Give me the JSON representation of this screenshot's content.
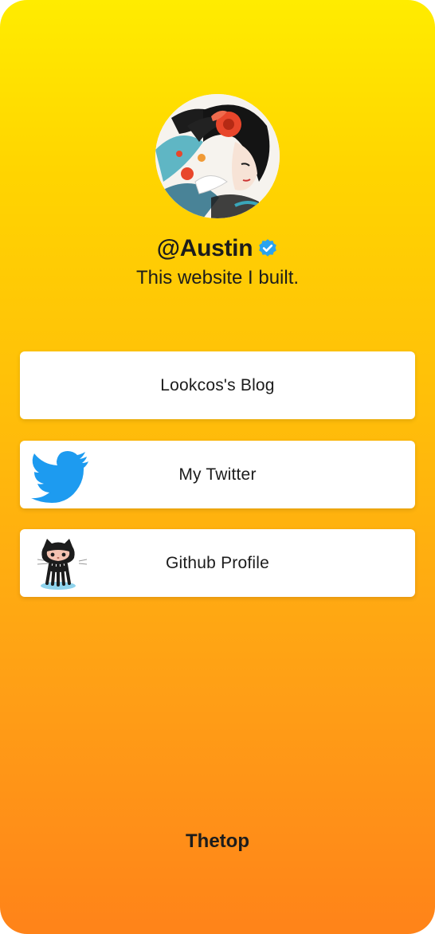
{
  "profile": {
    "username": "@Austin",
    "bio": "This website I built."
  },
  "links": [
    {
      "label": "Lookcos's Blog",
      "icon": "none"
    },
    {
      "label": "My Twitter",
      "icon": "twitter-bird-icon"
    },
    {
      "label": "Github Profile",
      "icon": "github-octocat-icon"
    }
  ],
  "footer": {
    "text": "Thetop"
  },
  "colors": {
    "gradient_top": "#ffec00",
    "gradient_bottom": "#ff8319",
    "verified_blue": "#2aa3ef",
    "twitter_blue": "#1d9bf0",
    "card_bg": "#ffffff"
  }
}
